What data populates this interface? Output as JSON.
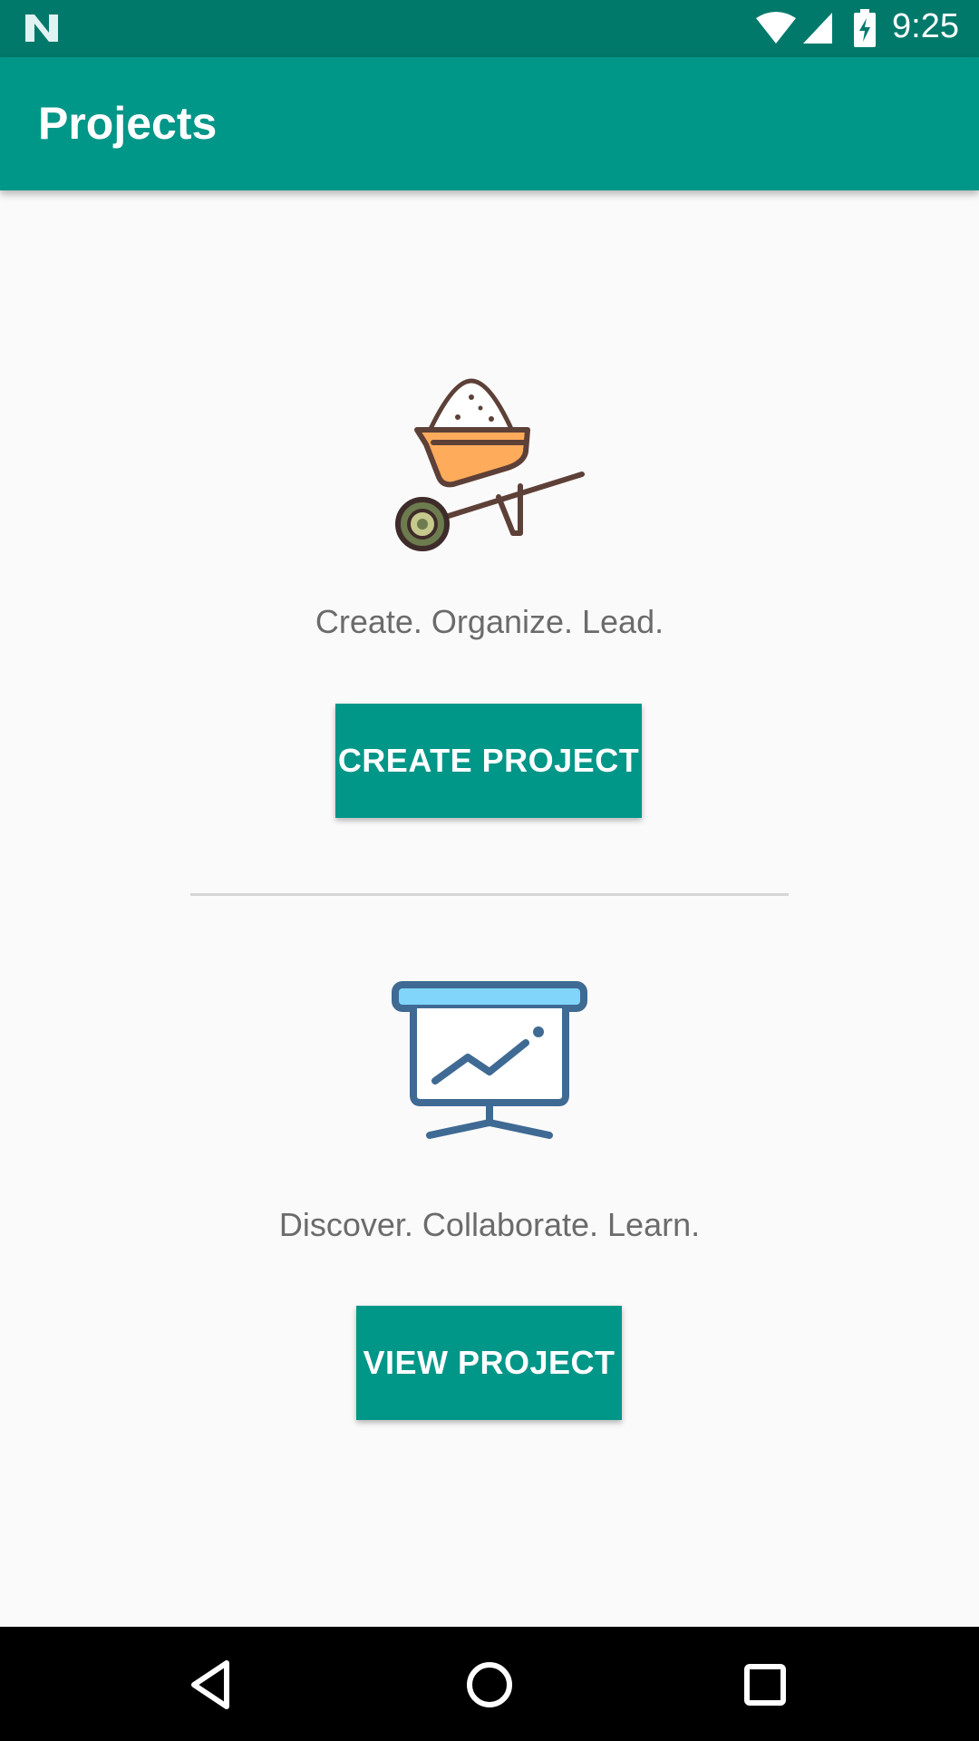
{
  "status_bar": {
    "time": "9:25",
    "icons": [
      "n-logo-icon",
      "wifi-icon",
      "signal-icon",
      "battery-charging-icon"
    ]
  },
  "app_bar": {
    "title": "Projects"
  },
  "sections": [
    {
      "icon": "wheelbarrow-icon",
      "tagline": "Create. Organize. Lead.",
      "button_label": "CREATE PROJECT"
    },
    {
      "icon": "presentation-chart-icon",
      "tagline": "Discover. Collaborate. Learn.",
      "button_label": "VIEW PROJECT"
    }
  ],
  "nav_bar": {
    "icons": [
      "back-icon",
      "home-icon",
      "recent-apps-icon"
    ]
  },
  "colors": {
    "status_bar": "#00796b",
    "app_bar": "#009688",
    "button": "#009688",
    "background": "#fafafa",
    "tagline_text": "#6b6b6b",
    "wheelbarrow_bucket": "#ffab5c",
    "wheel": "#6d7c4f",
    "presentation_stroke": "#3f6a93",
    "presentation_top": "#81d4fa"
  }
}
